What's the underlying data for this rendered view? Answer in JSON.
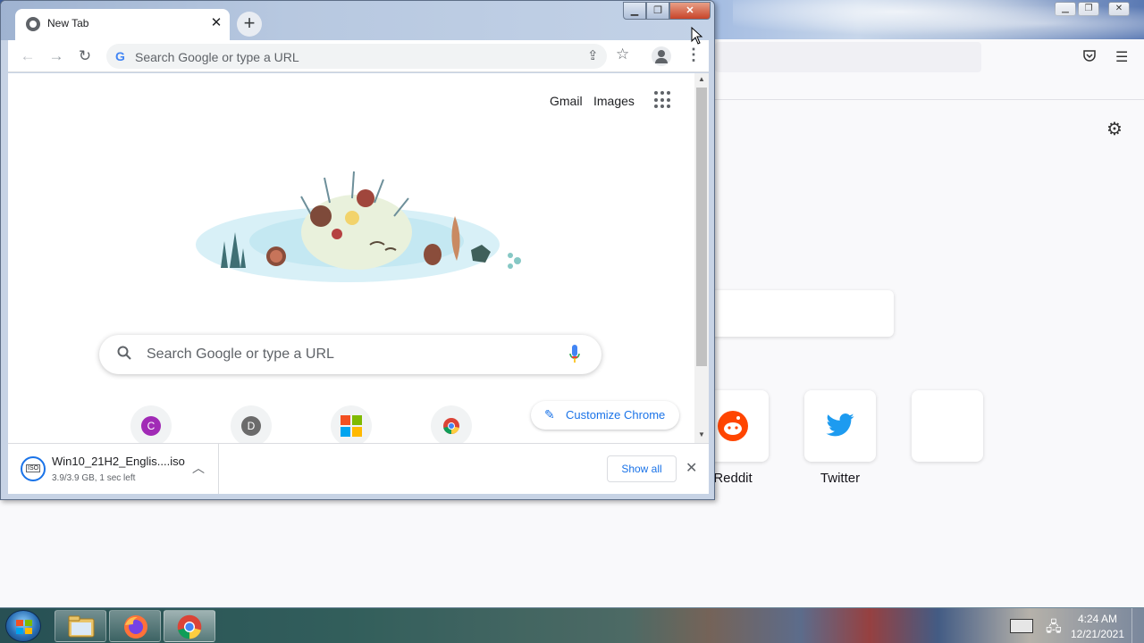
{
  "firefox": {
    "tiles": [
      {
        "label": "Reddit",
        "icon": "reddit-icon"
      },
      {
        "label": "Twitter",
        "icon": "twitter-icon"
      },
      {
        "label": "",
        "icon": ""
      }
    ]
  },
  "chrome": {
    "tab": {
      "title": "New Tab",
      "favicon": "chrome-icon",
      "close_glyph": "✕"
    },
    "new_tab_glyph": "+",
    "window_buttons": {
      "minimize": "▁",
      "maximize": "❐",
      "close": "✕"
    },
    "omnibox": {
      "placeholder": "Search Google or type a URL"
    },
    "header_links": {
      "gmail": "Gmail",
      "images": "Images"
    },
    "search": {
      "placeholder": "Search Google or type a URL"
    },
    "shortcuts": [
      {
        "letter": "C",
        "color": "#a12bb6"
      },
      {
        "letter": "D",
        "color": "#6b6b6b"
      },
      {
        "letter": "",
        "icon": "microsoft-icon"
      },
      {
        "letter": "",
        "icon": "chrome-icon"
      }
    ],
    "customize": {
      "label": "Customize Chrome"
    },
    "download": {
      "filename": "Win10_21H2_Englis....iso",
      "status": "3.9/3.9 GB, 1 sec left",
      "show_all": "Show all"
    }
  },
  "taskbar": {
    "time": "4:24 AM",
    "date": "12/21/2021"
  },
  "colors": {
    "google_blue": "#1a73e8",
    "close_red": "#c7442a"
  }
}
